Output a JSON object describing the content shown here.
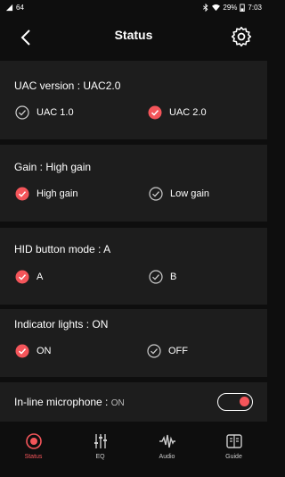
{
  "status_bar": {
    "signal": "64",
    "battery": "29%",
    "time": "7:03"
  },
  "header": {
    "title": "Status"
  },
  "sections": [
    {
      "label": "UAC version : ",
      "value": "UAC2.0",
      "options": [
        {
          "label": "UAC 1.0",
          "checked": false
        },
        {
          "label": "UAC 2.0",
          "checked": true
        }
      ]
    },
    {
      "label": "Gain : ",
      "value": "High gain",
      "options": [
        {
          "label": "High gain",
          "checked": true
        },
        {
          "label": "Low gain",
          "checked": false
        }
      ]
    },
    {
      "label": "HID button mode : ",
      "value": "A",
      "options": [
        {
          "label": "A",
          "checked": true
        },
        {
          "label": "B",
          "checked": false
        }
      ]
    },
    {
      "label": "Indicator lights : ",
      "value": "ON",
      "options": [
        {
          "label": "ON",
          "checked": true
        },
        {
          "label": "OFF",
          "checked": false
        }
      ]
    }
  ],
  "microphone": {
    "label": "In-line microphone : ",
    "value": "ON",
    "enabled": true
  },
  "nav": [
    {
      "label": "Status",
      "active": true
    },
    {
      "label": "EQ",
      "active": false
    },
    {
      "label": "Audio",
      "active": false
    },
    {
      "label": "Guide",
      "active": false
    }
  ],
  "colors": {
    "accent": "#f4555a",
    "section_bg": "#1d1d1d",
    "page_bg": "#0e0e0e"
  }
}
